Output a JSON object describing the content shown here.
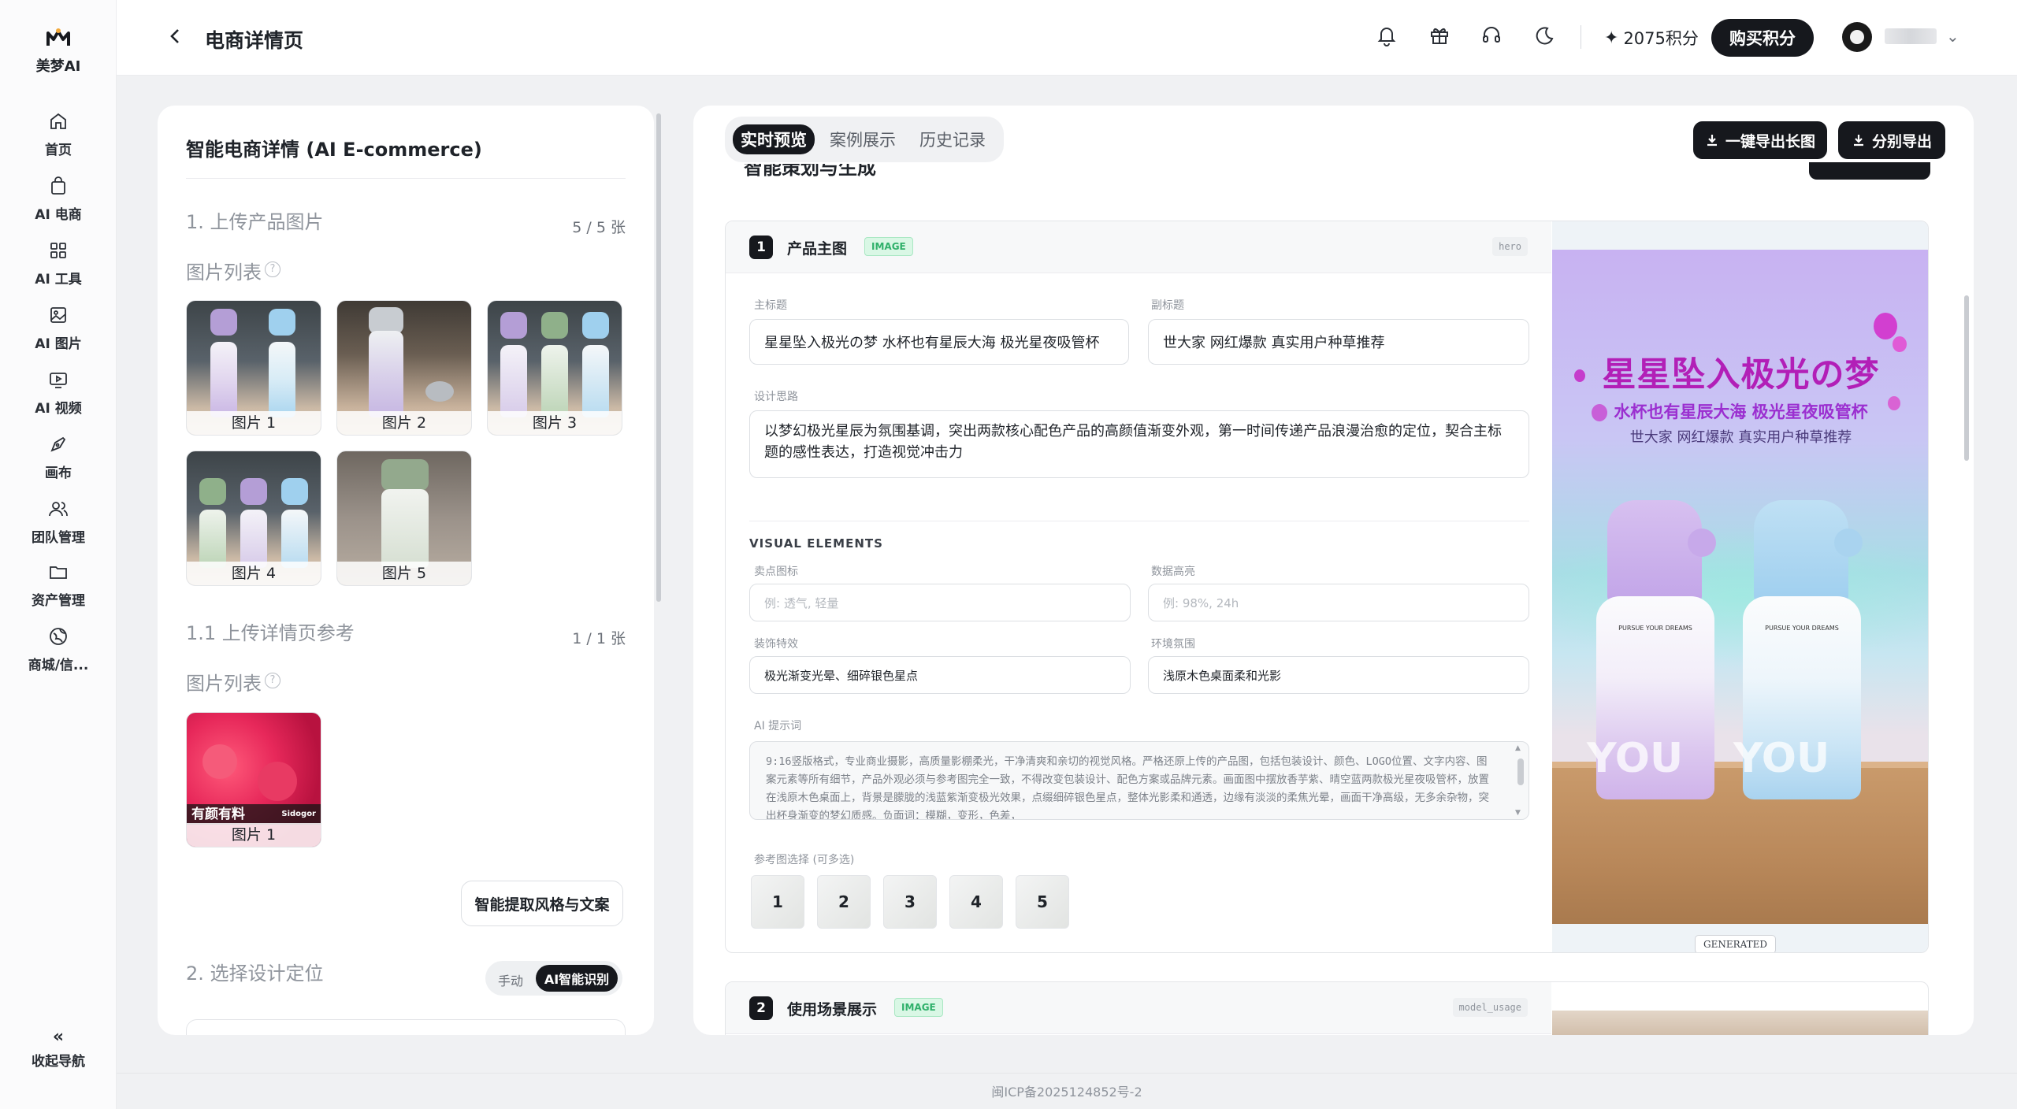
{
  "app": {
    "name": "美梦AI",
    "page_title": "电商详情页",
    "footer": "闽ICP备2025124852号-2"
  },
  "sidebar": {
    "items": [
      {
        "label": "首页",
        "icon": "home-icon"
      },
      {
        "label": "AI 电商",
        "icon": "shopping-bag-icon"
      },
      {
        "label": "AI 工具",
        "icon": "grid-icon"
      },
      {
        "label": "AI 图片",
        "icon": "image-icon"
      },
      {
        "label": "AI 视频",
        "icon": "video-icon"
      },
      {
        "label": "画布",
        "icon": "brush-icon"
      },
      {
        "label": "团队管理",
        "icon": "team-icon"
      },
      {
        "label": "资产管理",
        "icon": "folder-icon"
      },
      {
        "label": "商城/信...",
        "icon": "globe-icon"
      }
    ],
    "collapse_label": "收起导航"
  },
  "header": {
    "points": "2075积分",
    "buy_label": "购买积分"
  },
  "left": {
    "title": "智能电商详情 (AI E-commerce)",
    "upload_section": "1. 上传产品图片",
    "upload_count": "5 / 5 张",
    "list_title": "图片列表",
    "images": [
      "图片 1",
      "图片 2",
      "图片 3",
      "图片 4",
      "图片 5"
    ],
    "ref_section": "1.1 上传详情页参考",
    "ref_count": "1 / 1 张",
    "ref_list_title": "图片列表",
    "ref_images": [
      "图片 1"
    ],
    "ref_overlay_text": "有颜有料",
    "ref_brand": "Sidogor",
    "extract_label": "智能提取风格与文案",
    "design_section": "2. 选择设计定位",
    "mode_manual": "手动",
    "mode_ai": "AI智能识别"
  },
  "right": {
    "tabs": [
      "实时预览",
      "案例展示",
      "历史记录"
    ],
    "active_tab": "实时预览",
    "export_long": "一键导出长图",
    "export_split": "分别导出",
    "cut_title": "智能策划与生成",
    "card1": {
      "num": "1",
      "title": "产品主图",
      "tag": "IMAGE",
      "key": "hero",
      "main_title_label": "主标题",
      "main_title": "星星坠入极光の梦 水杯也有星辰大海 极光星夜吸管杯",
      "sub_title_label": "副标题",
      "sub_title": "世大家 网红爆款 真实用户种草推荐",
      "design_label": "设计思路",
      "design_text": "以梦幻极光星辰为氛围基调，突出两款核心配色产品的高颜值渐变外观，第一时间传递产品浪漫治愈的定位，契合主标题的感性表达，打造视觉冲击力",
      "ve_title": "VISUAL ELEMENTS",
      "selling_label": "卖点图标",
      "selling_ph": "例: 透气, 轻量",
      "data_label": "数据高亮",
      "data_ph": "例: 98%, 24h",
      "deco_label": "装饰特效",
      "deco_value": "极光渐变光晕、细碎银色星点",
      "env_label": "环境氛围",
      "env_value": "浅原木色桌面柔和光影",
      "ai_label": "AI 提示词",
      "ai_prompt": "9:16竖版格式，专业商业摄影，高质量影棚柔光，干净清爽和亲切的视觉风格。严格还原上传的产品图，包括包装设计、颜色、LOGO位置、文字内容、图案元素等所有细节，产品外观必须与参考图完全一致，不得改变包装设计、配色方案或品牌元素。画面图中摆放香芋紫、晴空蓝两款极光星夜吸管杯，放置在浅原木色桌面上，背景是朦胧的浅蓝紫渐变极光效果，点缀细碎银色星点，整体光影柔和通透，边缘有淡淡的柔焦光晕，画面干净高级，无多余杂物，突出杯身渐变的梦幻质感。负面词：模糊，变形，色差，",
      "ref_label": "参考图选择 (可多选)",
      "ref_nums": [
        "1",
        "2",
        "3",
        "4",
        "5"
      ],
      "poster_title": "星星坠入极光の梦",
      "poster_sub": "水杯也有星辰大海 极光星夜吸管杯",
      "poster_sub2": "世大家 网红爆款 真实用户种草推荐",
      "bottle_text": "YOU",
      "bottle_tagline": "PURSUE YOUR DREAMS",
      "generated_badge": "GENERATED"
    },
    "card2": {
      "num": "2",
      "title": "使用场景展示",
      "tag": "IMAGE",
      "key": "model_usage"
    }
  },
  "colors": {
    "dark": "#16181d",
    "accent_green": "#2fb06a",
    "poster_magenta": "#b21fb7",
    "lavender": "#c8b2f2",
    "sky_blue": "#9fd2ef"
  }
}
